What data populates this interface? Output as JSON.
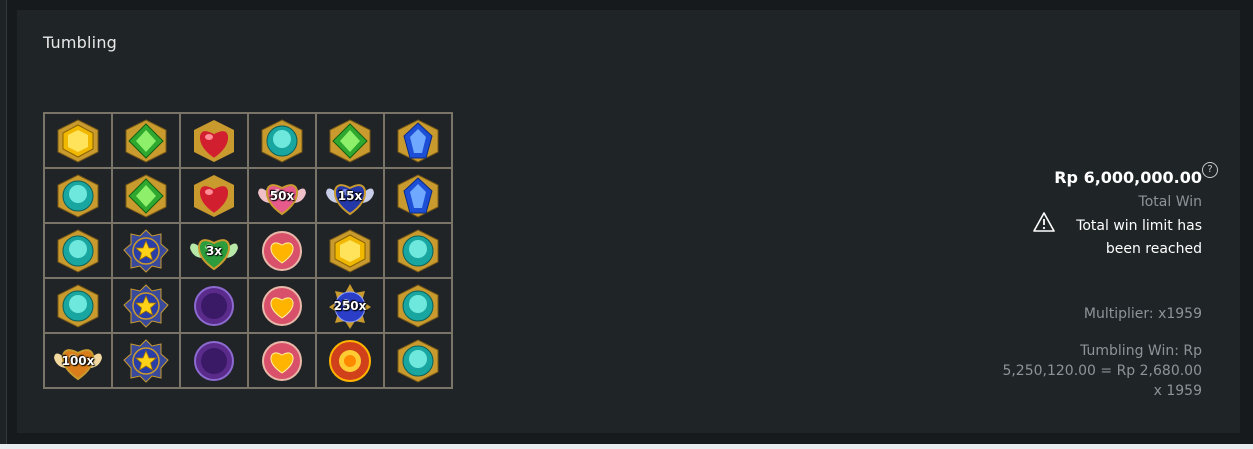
{
  "title": "Tumbling",
  "grid": [
    [
      {
        "symbol": "yellow-gem"
      },
      {
        "symbol": "green-gem"
      },
      {
        "symbol": "red-heart-gem"
      },
      {
        "symbol": "teal-gem"
      },
      {
        "symbol": "green-gem"
      },
      {
        "symbol": "blue-gem"
      }
    ],
    [
      {
        "symbol": "teal-gem"
      },
      {
        "symbol": "green-gem"
      },
      {
        "symbol": "red-heart-gem"
      },
      {
        "symbol": "pink-winged-heart",
        "mult": "50x"
      },
      {
        "symbol": "blue-winged-heart",
        "mult": "15x"
      },
      {
        "symbol": "blue-gem"
      }
    ],
    [
      {
        "symbol": "teal-gem"
      },
      {
        "symbol": "star-badge"
      },
      {
        "symbol": "green-winged-heart",
        "mult": "3x"
      },
      {
        "symbol": "heart-locket"
      },
      {
        "symbol": "yellow-gem"
      },
      {
        "symbol": "teal-gem"
      }
    ],
    [
      {
        "symbol": "teal-gem"
      },
      {
        "symbol": "star-badge"
      },
      {
        "symbol": "moon-badge"
      },
      {
        "symbol": "heart-locket"
      },
      {
        "symbol": "blue-orb",
        "mult": "250x"
      },
      {
        "symbol": "teal-gem"
      }
    ],
    [
      {
        "symbol": "gold-winged-heart",
        "mult": "100x"
      },
      {
        "symbol": "star-badge"
      },
      {
        "symbol": "moon-badge"
      },
      {
        "symbol": "heart-locket"
      },
      {
        "symbol": "sun-badge"
      },
      {
        "symbol": "teal-gem"
      }
    ]
  ],
  "summary": {
    "amount": "Rp 6,000,000.00",
    "help_icon": "?",
    "total_win_label": "Total Win",
    "warning_icon": "warning-triangle",
    "limit_text": "Total win limit has been reached",
    "multiplier": "Multiplier: x1959",
    "tumbling_win": "Tumbling Win: Rp 5,250,120.00 = Rp 2,680.00 x 1959"
  },
  "colors": {
    "background": "#161a1d",
    "panel": "#1f2427",
    "grid_border": "#7a7468",
    "muted_text": "#8d9398"
  }
}
